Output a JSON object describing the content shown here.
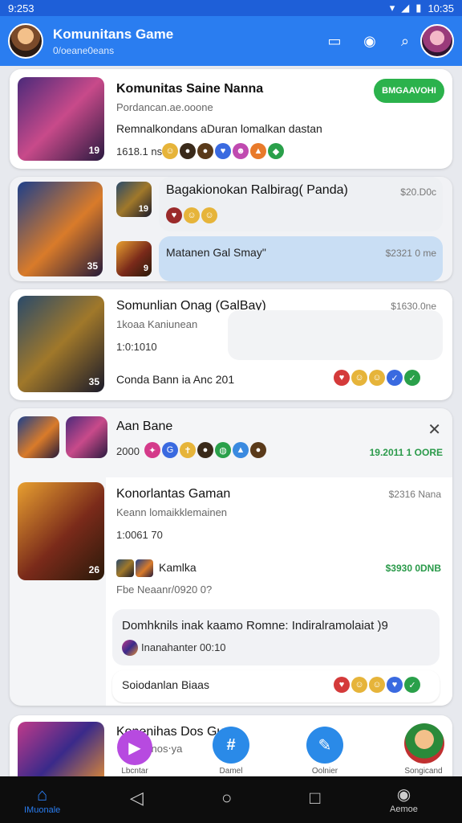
{
  "status_bar": {
    "time": "9:253",
    "clock": "10:35"
  },
  "app_bar": {
    "title": "Komunitans Game",
    "subtitle": "0/oeane0eans"
  },
  "cards": {
    "c1": {
      "name": "Komunitas Saine Nanna",
      "sub": "Pordancan.ae.ooone",
      "body": "Remnalkondans aDuran lomalkan dastan",
      "meta": "1618.1 ns",
      "button": "BMGAAVOHI"
    },
    "c2": {
      "name": "Bagakionokan Ralbirag( Panda)",
      "price": "$20.D0c",
      "reply_name": "Matanen Gal Smay\"",
      "reply_price": "$2321 0 me"
    },
    "c3": {
      "name": "Somunlian Onag (GalBay)",
      "price": "$1630.0ne",
      "sub": "1koaa Kaniunean",
      "meta": "1:0:1010",
      "footer": "Conda Bann ia Anc 201"
    },
    "c4": {
      "header": "Aan Bane",
      "meta": "2000",
      "right": "19.2011 1 OORE",
      "p1_name": "Konorlantas Gaman",
      "p1_price": "$2316 Nana",
      "p1_sub": "Keann lomaikklemainen",
      "p1_meta": "1:0061 70",
      "p2_name": "Kamlka",
      "p2_price": "$3930 0DNB",
      "p2_sub": "Fbe Neaanr/0920 0?",
      "quote": "Domhknils inak kaamo Romne: Indiralramolaiat )9",
      "quote_sub": "Inanahanter 00:10",
      "footer": "Soiodanlan Biaas"
    },
    "c5": {
      "name": "Konenihas Dos Gun",
      "sub": "snos‧ya"
    }
  },
  "fab_labels": [
    "Lbcntar",
    "Damel",
    "Oolnier",
    "Songicand"
  ],
  "bottom_nav": {
    "home_label": "IMuonale",
    "account_label": "Aemoe"
  },
  "colors": {
    "primary": "#2a7df0",
    "accent_green": "#2bb24c",
    "status": "#1e5fd8"
  }
}
